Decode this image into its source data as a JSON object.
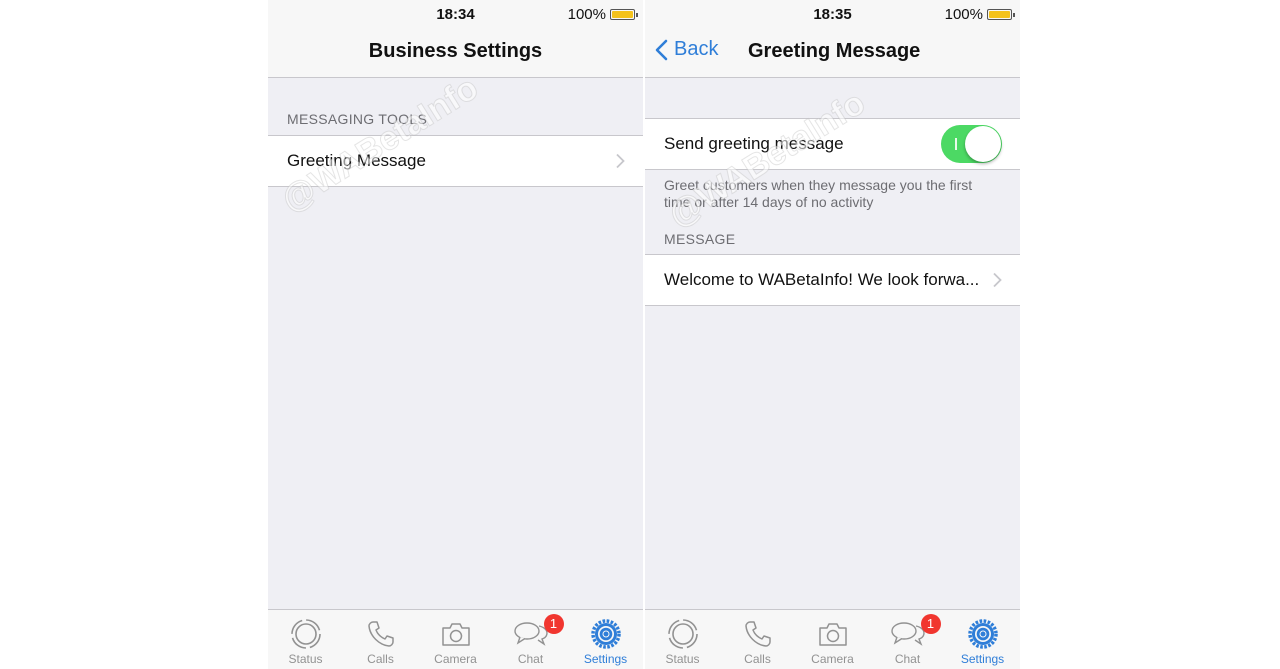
{
  "left_screen": {
    "status_bar": {
      "time": "18:34",
      "battery": "100%"
    },
    "nav": {
      "title": "Business Settings"
    },
    "section_header": "MESSAGING TOOLS",
    "items": [
      {
        "label": "Greeting Message",
        "icon": "chevron-right-icon"
      }
    ],
    "watermark": "@WABetaInfo"
  },
  "right_screen": {
    "status_bar": {
      "time": "18:35",
      "battery": "100%"
    },
    "nav": {
      "back_label": "Back",
      "title": "Greeting Message"
    },
    "toggle_row": {
      "label": "Send greeting message",
      "enabled": true
    },
    "toggle_footer": "Greet customers when they message you the first time or after 14 days of no activity",
    "message_section_header": "MESSAGE",
    "message_preview": "Welcome to WABetaInfo! We look forwa...",
    "watermark": "@WABetaInfo"
  },
  "tab_bar": {
    "tabs": [
      {
        "label": "Status",
        "icon": "status-icon"
      },
      {
        "label": "Calls",
        "icon": "phone-icon"
      },
      {
        "label": "Camera",
        "icon": "camera-icon"
      },
      {
        "label": "Chat",
        "icon": "chat-bubbles-icon",
        "badge": "1"
      },
      {
        "label": "Settings",
        "icon": "gear-icon",
        "active": true
      }
    ]
  },
  "colors": {
    "accent": "#2f7ed8",
    "toggle_on": "#4cd964",
    "badge": "#f1362f",
    "battery": "#f4c21b",
    "background": "#efeff4"
  }
}
